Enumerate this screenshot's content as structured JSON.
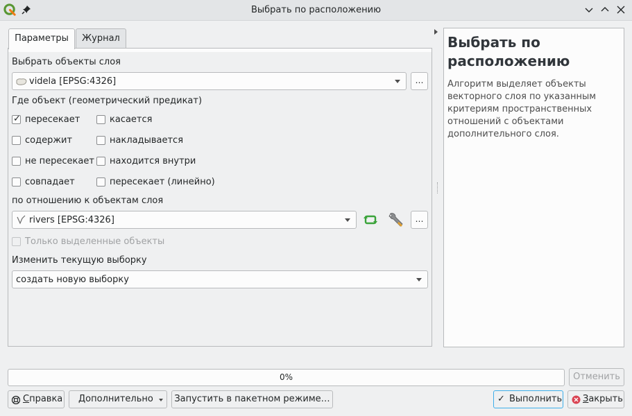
{
  "window": {
    "title": "Выбрать по расположению"
  },
  "tabs": [
    {
      "label": "Параметры",
      "active": true
    },
    {
      "label": "Журнал",
      "active": false
    }
  ],
  "params": {
    "select_layer_label": "Выбрать объекты слоя",
    "select_layer_value": "videla [EPSG:4326]",
    "predicate_label": "Где объект (геометрический предикат)",
    "predicates": [
      {
        "label": "пересекает",
        "checked": true
      },
      {
        "label": "касается",
        "checked": false
      },
      {
        "label": "содержит",
        "checked": false
      },
      {
        "label": "накладывается",
        "checked": false
      },
      {
        "label": "не пересекает",
        "checked": false
      },
      {
        "label": "находится внутри",
        "checked": false
      },
      {
        "label": "совпадает",
        "checked": false
      },
      {
        "label": "пересекает (линейно)",
        "checked": false
      }
    ],
    "compare_layer_label": "по отношению к объектам слоя",
    "compare_layer_value": "rivers [EPSG:4326]",
    "selected_only_label": "Только выделенные объекты",
    "modify_label": "Изменить текущую выборку",
    "modify_value": "создать новую выборку",
    "dots_label": "…"
  },
  "help": {
    "title": "Выбрать по расположению",
    "body": "Алгоритм выделяет объекты векторного слоя по указанным критериям пространственных отношений с объектами дополнительного слоя."
  },
  "progress": {
    "value": 0,
    "text": "0%"
  },
  "buttons": {
    "cancel": "Отменить",
    "help_underline": "С",
    "help_rest": "правка",
    "advanced": "Дополнительно",
    "batch": "Запустить в пакетном режиме…",
    "run": "Выполнить",
    "close_underline": "З",
    "close_rest": "акрыть"
  },
  "colors": {
    "accent": "#3daee9",
    "qgis_green": "#589632",
    "qgis_yellow": "#ee7913",
    "close_red": "#da4453"
  }
}
